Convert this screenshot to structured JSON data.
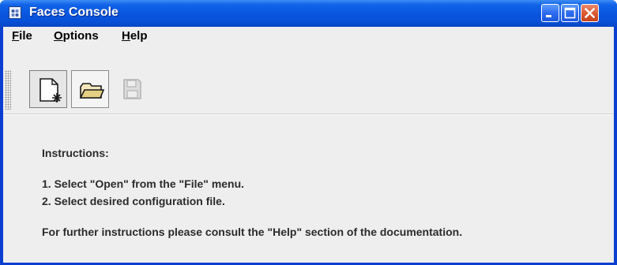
{
  "window": {
    "title": "Faces Console",
    "colors": {
      "titlebar": "#0a55de",
      "client": "#eeeeee",
      "close_button": "#dc5c33"
    }
  },
  "title_buttons": {
    "minimize_icon": "minimize-icon",
    "maximize_icon": "maximize-icon",
    "close_icon": "close-icon"
  },
  "menubar": {
    "items": [
      {
        "label": "File",
        "mnemonic": "F",
        "rest": "ile"
      },
      {
        "label": "Options",
        "mnemonic": "O",
        "rest": "ptions"
      },
      {
        "label": "Help",
        "mnemonic": "H",
        "rest": "elp"
      }
    ]
  },
  "toolbar": {
    "buttons": [
      {
        "icon": "new-document-icon",
        "enabled": true
      },
      {
        "icon": "open-folder-icon",
        "enabled": true
      },
      {
        "icon": "save-floppy-icon",
        "enabled": false
      }
    ]
  },
  "instructions": {
    "heading": "Instructions:",
    "steps": [
      "1. Select \"Open\" from the \"File\" menu.",
      "2. Select desired configuration file."
    ],
    "footer": "For further instructions please consult the \"Help\" section of the documentation."
  }
}
